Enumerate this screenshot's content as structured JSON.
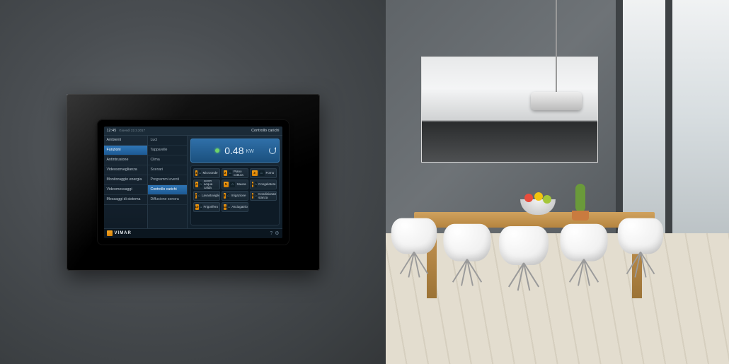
{
  "topbar": {
    "time": "12:45",
    "date": "Giovedì 22.3.2017",
    "title": "Controllo carichi"
  },
  "sidebar": {
    "items": [
      {
        "label": "Ambienti"
      },
      {
        "label": "Funzioni"
      },
      {
        "label": "Antintrusione"
      },
      {
        "label": "Videosorveglianza"
      },
      {
        "label": "Monitoraggio energia"
      },
      {
        "label": "Videomessaggi"
      },
      {
        "label": "Messaggi di sistema"
      }
    ],
    "activeIndex": 1
  },
  "functions": {
    "items": [
      {
        "label": "Luci"
      },
      {
        "label": "Tapparelle"
      },
      {
        "label": "Clima"
      },
      {
        "label": "Scenari"
      },
      {
        "label": "Programmi eventi"
      },
      {
        "label": "Controllo carichi"
      },
      {
        "label": "Diffusione sonora"
      }
    ],
    "activeIndex": 5
  },
  "power": {
    "value": "0.48",
    "unit": "KW"
  },
  "loads": [
    {
      "n": 1,
      "label": "Microonde"
    },
    {
      "n": 2,
      "label": "Piano cottura"
    },
    {
      "n": 3,
      "label": "Forno"
    },
    {
      "n": 4,
      "label": "Boiler acqua calda"
    },
    {
      "n": 5,
      "label": "Sauna"
    },
    {
      "n": 6,
      "label": "Congelatore"
    },
    {
      "n": 7,
      "label": "Lavastoviglie"
    },
    {
      "n": 8,
      "label": "Irrigazione"
    },
    {
      "n": 9,
      "label": "Condizionamento stanza"
    },
    {
      "n": 10,
      "label": "Frigorifero"
    },
    {
      "n": 11,
      "label": "Asciugatrice"
    }
  ],
  "brand": "VIMAR"
}
